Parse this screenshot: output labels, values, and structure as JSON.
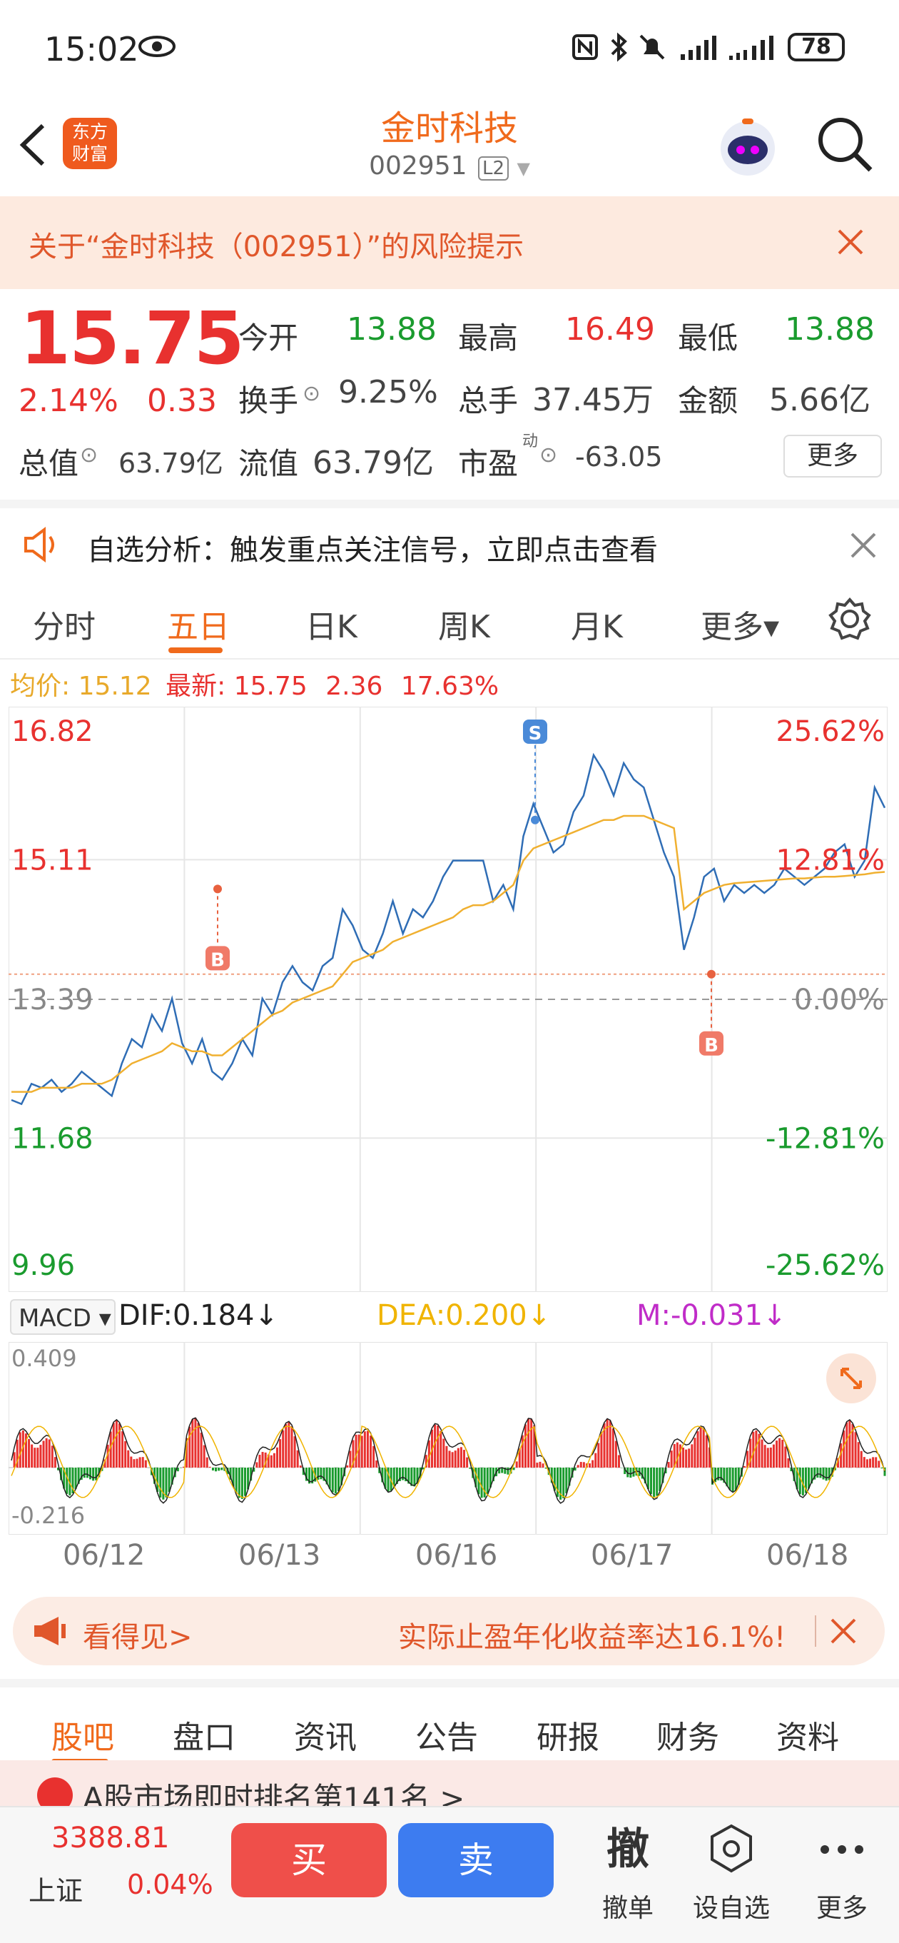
{
  "status_bar": {
    "time": "15:02",
    "battery": "78"
  },
  "header": {
    "title": "金时科技",
    "code": "002951",
    "level_badge": "L2",
    "logo_text_line1": "东方",
    "logo_text_line2": "财富"
  },
  "risk_banner": {
    "text": "关于“金时科技（002951）”的风险提示"
  },
  "quote": {
    "price": "15.75",
    "change_pct": "2.14%",
    "change": "0.33",
    "open_label": "今开",
    "open": "13.88",
    "high_label": "最高",
    "high": "16.49",
    "low_label": "最低",
    "low": "13.88",
    "turnover_label": "换手",
    "turnover": "9.25%",
    "volume_label": "总手",
    "volume": "37.45万",
    "amount_label": "金额",
    "amount": "5.66亿",
    "total_cap_label": "总值",
    "total_cap": "63.79亿",
    "float_cap_label": "流值",
    "float_cap": "63.79亿",
    "pe_label": "市盈",
    "pe_sup": "动",
    "pe": "-63.05",
    "more_label": "更多"
  },
  "analysis_bar": {
    "text": "自选分析：触发重点关注信号，立即点击查看"
  },
  "chart_tabs": [
    {
      "label": "分时"
    },
    {
      "label": "五日"
    },
    {
      "label": "日K"
    },
    {
      "label": "周K"
    },
    {
      "label": "月K"
    },
    {
      "label": "更多▾"
    }
  ],
  "legend": {
    "avg_label": "均价:",
    "avg": "15.12",
    "last_label": "最新:",
    "last": "15.75",
    "chg": "2.36",
    "chg_pct": "17.63%"
  },
  "chart_data": {
    "type": "line",
    "title": "",
    "x_dates": [
      "06/12",
      "06/13",
      "06/16",
      "06/17",
      "06/18"
    ],
    "ylim": [
      9.96,
      16.82
    ],
    "y_ticks_left": [
      "16.82",
      "15.11",
      "13.39",
      "11.68",
      "9.96"
    ],
    "y_ticks_right": [
      "25.62%",
      "12.81%",
      "0.00%",
      "-12.81%",
      "-25.62%"
    ],
    "prev_close": 13.39,
    "last_price": 15.75,
    "series": [
      {
        "values": [
          12.15,
          12.1,
          12.35,
          12.3,
          12.4,
          12.25,
          12.35,
          12.5,
          12.4,
          12.3,
          12.2,
          12.6,
          12.9,
          12.8,
          13.2,
          13.0,
          13.4,
          12.85,
          12.6,
          12.9,
          12.5,
          12.4,
          12.6,
          12.9,
          12.7,
          13.4,
          13.2,
          13.6,
          13.8,
          13.6,
          13.5,
          13.8,
          13.9,
          14.5,
          14.3,
          14.0,
          13.9,
          14.2,
          14.6,
          14.2,
          14.5,
          14.4,
          14.6,
          14.9,
          15.1,
          15.1,
          15.1,
          15.1,
          14.6,
          14.8,
          14.5,
          15.4,
          15.8,
          15.5,
          15.2,
          15.3,
          15.7,
          15.9,
          16.4,
          16.2,
          15.9,
          16.3,
          16.1,
          16.0,
          15.6,
          15.2,
          14.9,
          14.0,
          14.4,
          14.9,
          15.0,
          14.6,
          14.8,
          14.7,
          14.8,
          14.7,
          14.8,
          15.0,
          14.9,
          14.8,
          14.9,
          15.0,
          15.2,
          15.3,
          14.9,
          15.1,
          16.0,
          15.75
        ]
      },
      {
        "values": [
          12.25,
          12.25,
          12.25,
          12.3,
          12.3,
          12.3,
          12.3,
          12.35,
          12.35,
          12.35,
          12.4,
          12.5,
          12.6,
          12.65,
          12.7,
          12.75,
          12.85,
          12.8,
          12.75,
          12.75,
          12.7,
          12.7,
          12.8,
          12.9,
          13.0,
          13.1,
          13.2,
          13.25,
          13.35,
          13.4,
          13.45,
          13.5,
          13.55,
          13.7,
          13.85,
          13.9,
          13.95,
          14.0,
          14.1,
          14.15,
          14.2,
          14.25,
          14.3,
          14.35,
          14.4,
          14.5,
          14.55,
          14.55,
          14.6,
          14.7,
          14.8,
          15.1,
          15.25,
          15.3,
          15.35,
          15.4,
          15.45,
          15.5,
          15.55,
          15.6,
          15.6,
          15.65,
          15.65,
          15.65,
          15.6,
          15.55,
          15.5,
          14.5,
          14.6,
          14.7,
          14.75,
          14.8,
          14.82,
          14.83,
          14.84,
          14.85,
          14.86,
          14.87,
          14.88,
          14.88,
          14.89,
          14.9,
          14.9,
          14.91,
          14.92,
          14.93,
          14.95,
          14.96
        ]
      }
    ],
    "marks": [
      {
        "label": "B"
      },
      {
        "label": "S"
      },
      {
        "label": "B"
      }
    ]
  },
  "macd": {
    "name": "MACD ▾",
    "dif": "DIF:0.184↓",
    "dea": "DEA:0.200↓",
    "m": "M:-0.031↓",
    "top": "0.409",
    "bottom": "-0.216"
  },
  "promo": {
    "left": "看得见>",
    "right": "实际止盈年化收益率达16.1%!"
  },
  "bottom_tabs": [
    {
      "label": "股吧"
    },
    {
      "label": "盘口"
    },
    {
      "label": "资讯"
    },
    {
      "label": "公告"
    },
    {
      "label": "研报"
    },
    {
      "label": "财务"
    },
    {
      "label": "资料"
    }
  ],
  "peek_text": "A股市场即时排名第141名 >",
  "footer": {
    "index_value": "3388.81",
    "index_name": "上证",
    "index_pct": "0.04%",
    "buy": "买",
    "sell": "卖",
    "cancel_icon": "撤",
    "cancel": "撤单",
    "watch": "设自选",
    "more": "更多"
  },
  "colors": {
    "accent": "#f06a1c",
    "up": "#e8312f",
    "down": "#1a9b2e",
    "price_line": "#2f6db5",
    "avg_line": "#f0b030",
    "dea": "#f0b400",
    "m": "#c02cc8"
  }
}
